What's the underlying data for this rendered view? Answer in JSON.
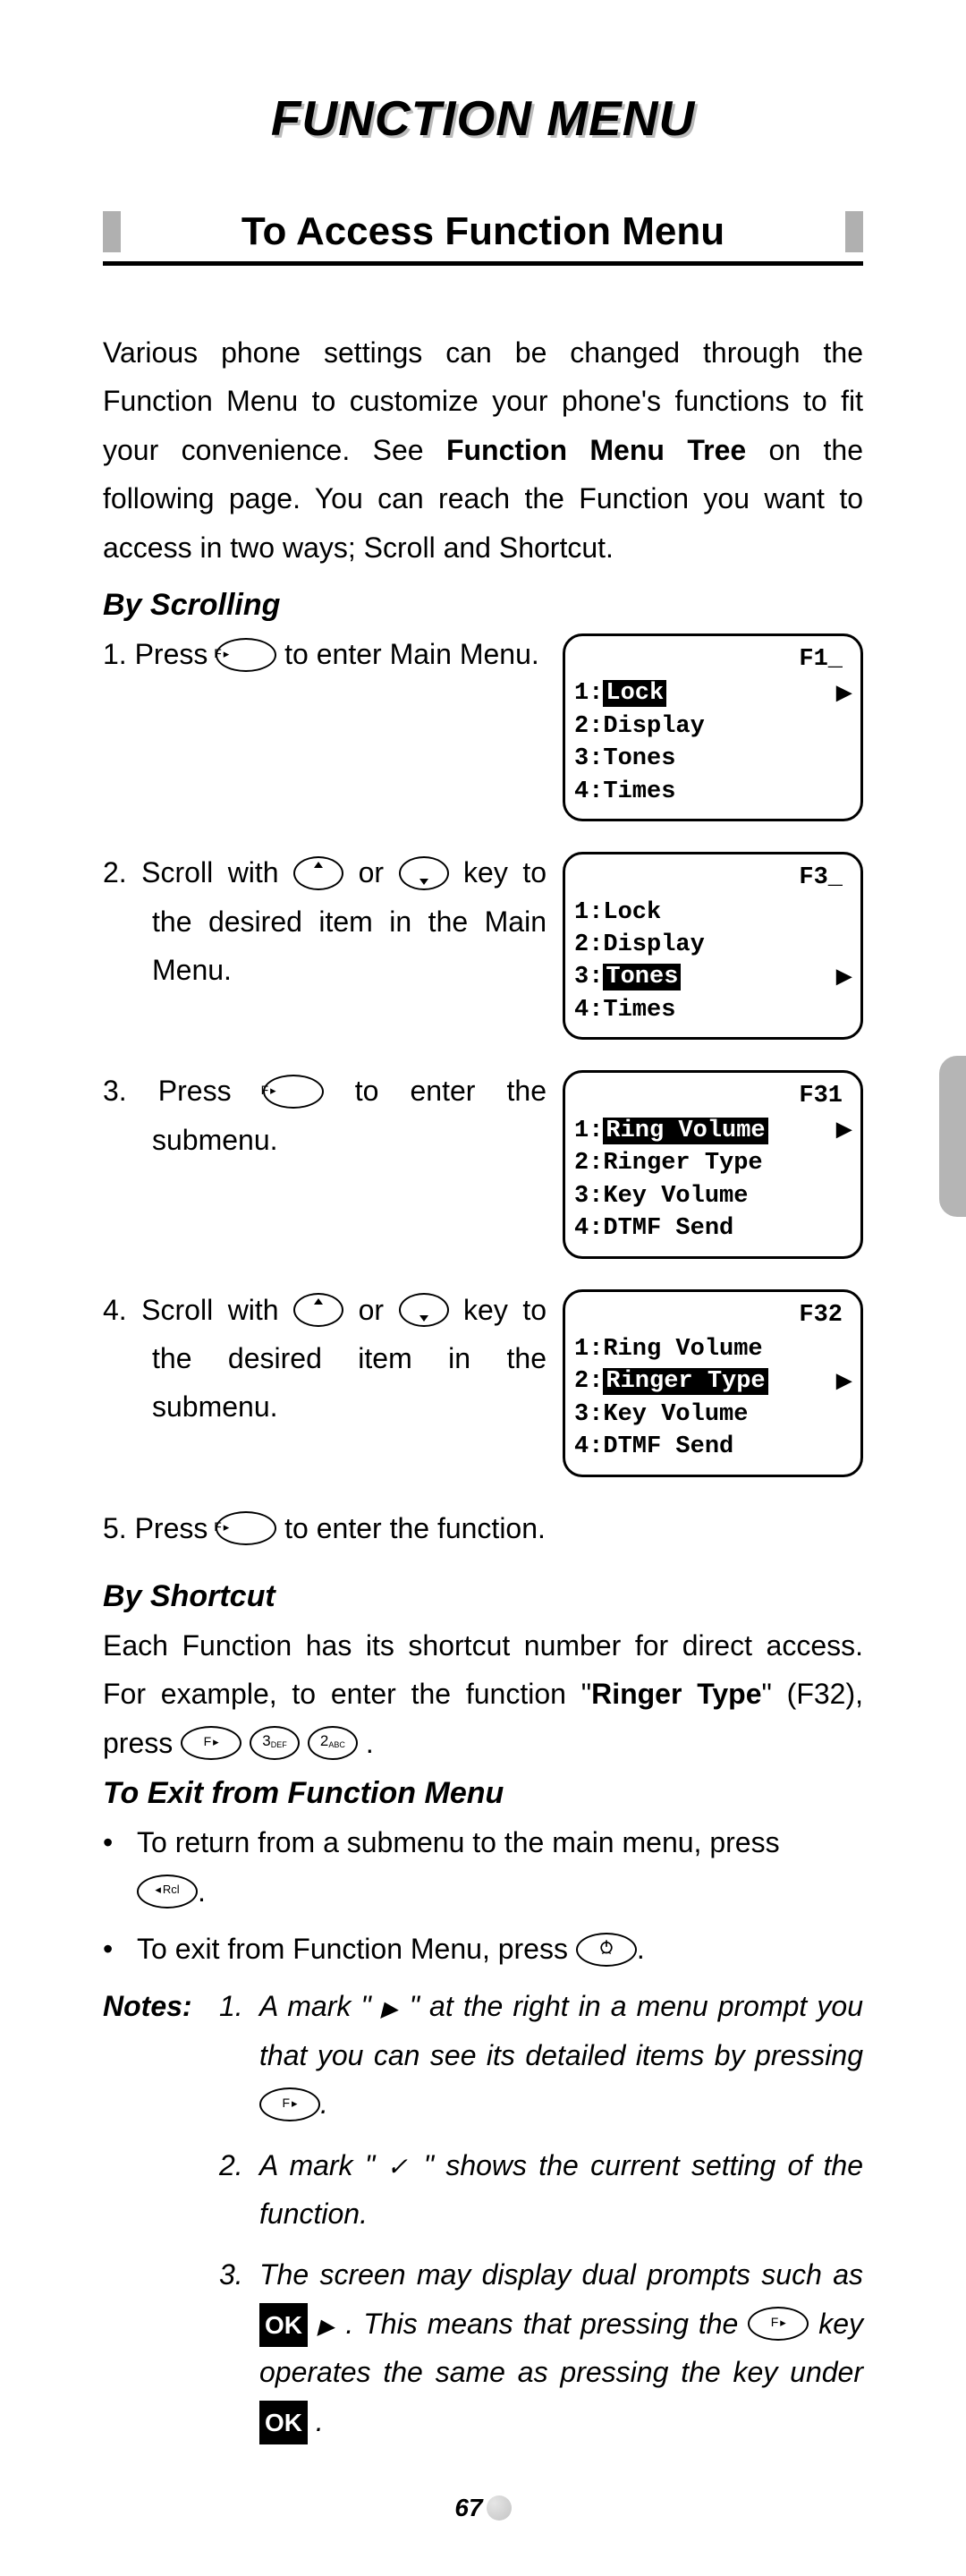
{
  "title": "FUNCTION MENU",
  "section": "To Access Function Menu",
  "intro_pre": "Various phone settings can be changed through the Function Menu to customize your phone's functions to fit your convenience. See ",
  "intro_bold": "Function Menu Tree",
  "intro_post": " on the following page. You can reach the Function you want to access in two ways; Scroll and Shortcut.",
  "by_scrolling": "By Scrolling",
  "by_shortcut": "By Shortcut",
  "to_exit": "To Exit from Function Menu",
  "step1_a": "1. Press ",
  "step1_b": " to enter Main Menu.",
  "step2_a": "2. Scroll with ",
  "step2_or": " or ",
  "step2_b": " key to the desired item in the Main Menu.",
  "step3_a": "3. Press ",
  "step3_b": " to enter the submenu.",
  "step4_a": "4. Scroll with ",
  "step4_b": " key to the desired item in the submenu.",
  "step5_a": "5. Press ",
  "step5_b": " to enter the function.",
  "shortcut_a": "Each Function has its shortcut number for direct access. For example, to enter the function \"",
  "shortcut_bold": "Ringer Type",
  "shortcut_b": "\" (F32), press ",
  "exit_b1": "To return from a submenu to the main menu, press ",
  "exit_b2": "To exit from Function Menu, press ",
  "notes_label": "Notes:",
  "note1_a": "A mark \" ",
  "note1_b": " \" at the right in a menu prompt you that you can see its detailed items by pressing ",
  "note2_a": "A mark \" ",
  "note2_b": " \" shows the current setting of the function.",
  "note3_a": "The screen may display dual prompts such as ",
  "note3_b": " . This means that pressing the ",
  "note3_c": " key operates the same as pressing the key under ",
  "key3": "3",
  "key3sup": "DEF",
  "key2": "2",
  "key2sup": "ABC",
  "rcl": "Rcl",
  "ok": "OK",
  "n1": "1.",
  "n2": "2.",
  "n3": "3.",
  "dot": "•",
  "period": ".",
  "screens": {
    "s1": {
      "hdr": "F1_",
      "items": [
        {
          "n": "1:",
          "t": "Lock",
          "sel": true
        },
        {
          "n": "2:",
          "t": "Display"
        },
        {
          "n": "3:",
          "t": "Tones"
        },
        {
          "n": "4:",
          "t": "Times"
        }
      ]
    },
    "s2": {
      "hdr": "F3_",
      "items": [
        {
          "n": "1:",
          "t": "Lock"
        },
        {
          "n": "2:",
          "t": "Display"
        },
        {
          "n": "3:",
          "t": "Tones",
          "sel": true
        },
        {
          "n": "4:",
          "t": "Times"
        }
      ]
    },
    "s3": {
      "hdr": "F31",
      "items": [
        {
          "n": "1:",
          "t": "Ring Volume",
          "sel": true
        },
        {
          "n": "2:",
          "t": "Ringer Type"
        },
        {
          "n": "3:",
          "t": "Key Volume"
        },
        {
          "n": "4:",
          "t": "DTMF Send"
        }
      ]
    },
    "s4": {
      "hdr": "F32",
      "items": [
        {
          "n": "1:",
          "t": "Ring Volume"
        },
        {
          "n": "2:",
          "t": "Ringer Type",
          "sel": true
        },
        {
          "n": "3:",
          "t": "Key Volume"
        },
        {
          "n": "4:",
          "t": "DTMF Send"
        }
      ]
    }
  },
  "page_number": "67"
}
